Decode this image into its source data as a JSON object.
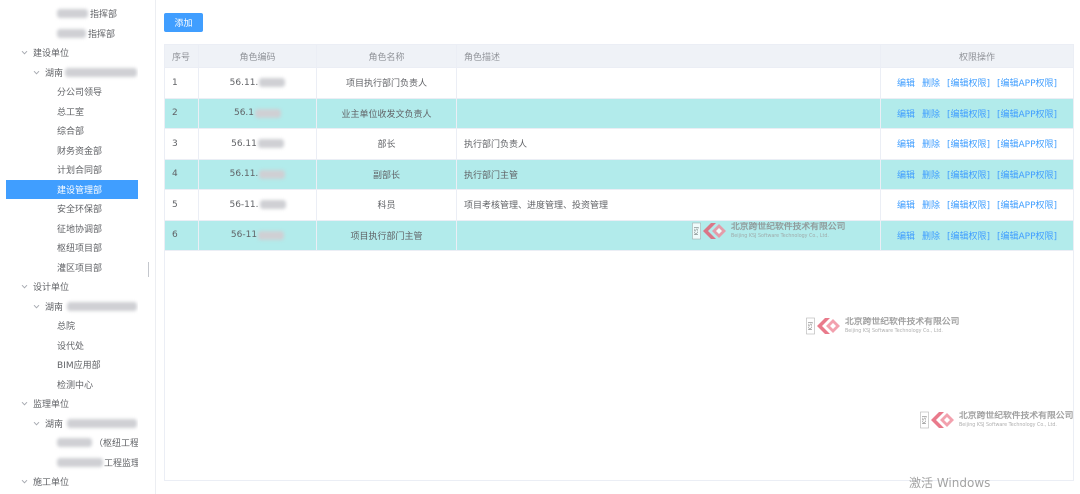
{
  "toolbar": {
    "add_label": "添加"
  },
  "colors": {
    "accent": "#409eff",
    "row_highlight": "#b2ebeb",
    "header_bg": "#eff2f7",
    "tree_selected_bg": "#409eff"
  },
  "icons": {
    "tree_expand": "chevron-down-icon",
    "watermark_logo": "ksj-logo-icon"
  },
  "tree": {
    "items": [
      {
        "label": "指挥部",
        "redacted_prefix": true
      },
      {
        "label": "指挥部",
        "redacted_prefix": true
      },
      {
        "label": "建设单位",
        "expanded": true
      },
      {
        "label": "湖南",
        "redacted_suffix": true,
        "expanded": true
      },
      {
        "label": "分公司领导"
      },
      {
        "label": "总工室"
      },
      {
        "label": "综合部"
      },
      {
        "label": "财务资金部"
      },
      {
        "label": "计划合同部"
      },
      {
        "label": "建设管理部",
        "selected": true
      },
      {
        "label": "安全环保部"
      },
      {
        "label": "征地协调部"
      },
      {
        "label": "枢纽项目部"
      },
      {
        "label": "灌区项目部"
      },
      {
        "label": "设计单位",
        "expanded": true
      },
      {
        "label": "湖南",
        "redacted_suffix": true,
        "expanded": true
      },
      {
        "label": "总院"
      },
      {
        "label": "设代处"
      },
      {
        "label": "BIM应用部"
      },
      {
        "label": "检测中心"
      },
      {
        "label": "监理单位",
        "expanded": true
      },
      {
        "label": "湖南",
        "redacted_suffix": true,
        "expanded": true
      },
      {
        "label": "（枢纽工程",
        "redacted_prefix": true
      },
      {
        "label": "工程监理",
        "redacted_prefix": true
      },
      {
        "label": "施工单位",
        "expanded": true
      }
    ]
  },
  "table": {
    "columns": [
      "序号",
      "角色编码",
      "角色名称",
      "角色描述",
      "权限操作"
    ],
    "actions": {
      "edit": "编辑",
      "delete": "删除",
      "edit_permissions": "[编辑权限]",
      "edit_app_permissions": "[编辑APP权限]"
    },
    "rows": [
      {
        "index": "1",
        "code": "56.11.",
        "name": "项目执行部门负责人",
        "description": "",
        "highlighted": false
      },
      {
        "index": "2",
        "code": "56.1",
        "name": "业主单位收发文负责人",
        "description": "",
        "highlighted": true
      },
      {
        "index": "3",
        "code": "56.11",
        "name": "部长",
        "description": "执行部门负责人",
        "highlighted": false
      },
      {
        "index": "4",
        "code": "56.11.",
        "name": "副部长",
        "description": "执行部门主管",
        "highlighted": true
      },
      {
        "index": "5",
        "code": "56-11.",
        "name": "科员",
        "description": "项目考核管理、进度管理、投资管理",
        "highlighted": false
      },
      {
        "index": "6",
        "code": "56-11",
        "name": "项目执行部门主管",
        "description": "",
        "highlighted": true
      }
    ]
  },
  "watermark": {
    "company_cn": "北京跨世纪软件技术有限公司",
    "company_en": "Beijing KSJ Software Technology Co., Ltd.",
    "logo_letters": "KSJ"
  },
  "system_overlay": {
    "activation_notice": "激活 Windows"
  }
}
